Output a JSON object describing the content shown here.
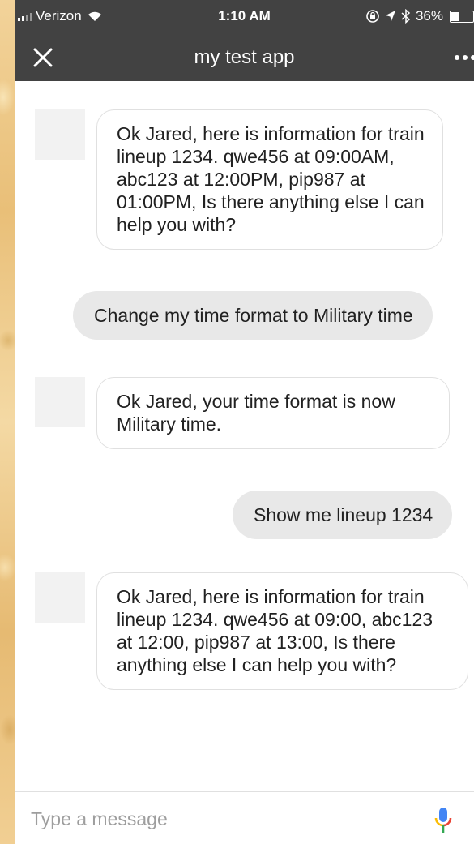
{
  "status_bar": {
    "carrier": "Verizon",
    "time": "1:10 AM",
    "battery": "36%",
    "battery_level": 0.36
  },
  "app_bar": {
    "title": "my test app",
    "close_icon": "close-icon",
    "more_icon": "more-horizontal-icon"
  },
  "messages": [
    {
      "sender": "bot",
      "text": "Ok Jared, here is information for train lineup 1234. qwe456 at 09:00AM, abc123 at 12:00PM, pip987 at 01:00PM, Is there anything else I can help you with?"
    },
    {
      "sender": "user",
      "text": "Change my time format to Military time"
    },
    {
      "sender": "bot",
      "text": "Ok Jared, your time format is now Military time."
    },
    {
      "sender": "user",
      "text": "Show me lineup 1234"
    },
    {
      "sender": "bot",
      "text": "Ok Jared, here is information for train lineup 1234. qwe456 at 09:00, abc123 at 12:00, pip987 at 13:00, Is there anything else I can help you with?"
    }
  ],
  "composer": {
    "placeholder": "Type a message",
    "mic_icon": "microphone-icon"
  },
  "colors": {
    "app_bar": "#424242",
    "bot_bubble_border": "#e0e0e0",
    "user_bubble": "#e8e8e8",
    "avatar_placeholder": "#f2f2f2",
    "mic_blue": "#4285f4",
    "mic_red": "#ea4335",
    "mic_yellow": "#fbbc05",
    "mic_green": "#34a853"
  }
}
